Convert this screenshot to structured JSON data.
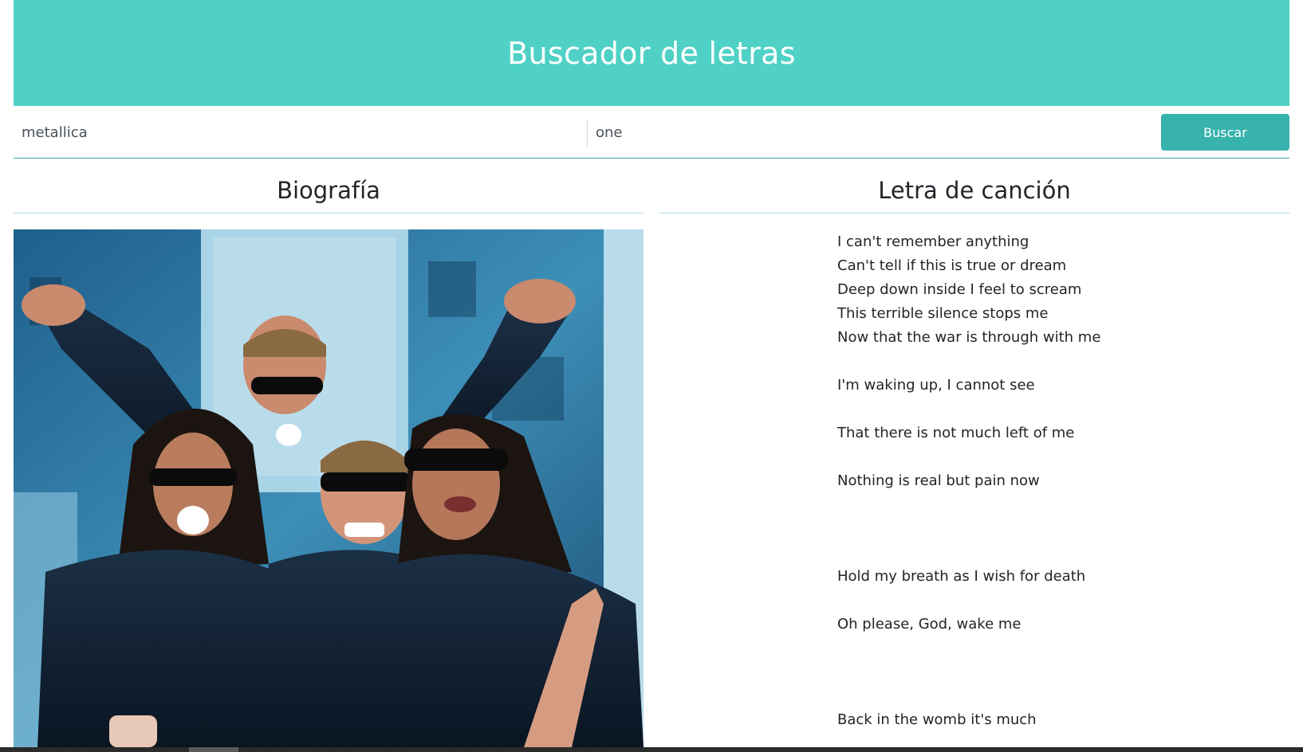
{
  "header": {
    "title": "Buscador de letras"
  },
  "search": {
    "artist_value": "metallica",
    "song_value": "one",
    "button_label": "Buscar"
  },
  "biography": {
    "title": "Biografía"
  },
  "lyrics": {
    "title": "Letra de canción",
    "lines": [
      "I can't remember anything",
      "Can't tell if this is true or dream",
      "Deep down inside I feel to scream",
      "This terrible silence stops me",
      "Now that the war is through with me",
      "",
      "I'm waking up, I cannot see",
      "",
      "That there is not much left of me",
      "",
      "Nothing is real but pain now",
      "",
      "",
      "",
      "Hold my breath as I wish for death",
      "",
      "Oh please, God, wake me",
      "",
      "",
      "",
      "Back in the womb it's much"
    ]
  },
  "colors": {
    "header_bg": "#4fd1c5",
    "button_bg": "#38b2ac"
  }
}
